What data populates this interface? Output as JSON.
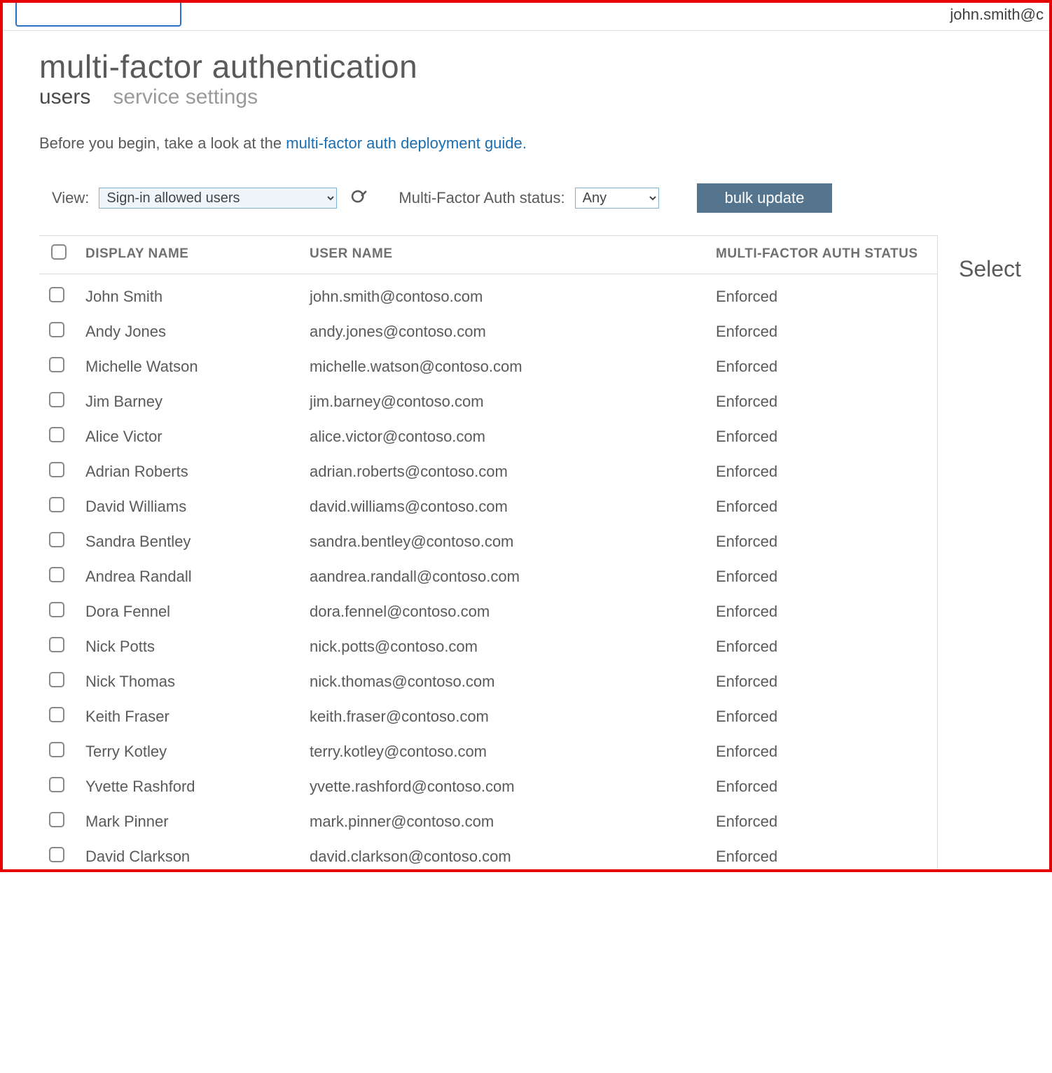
{
  "header": {
    "user_email_partial": "john.smith@c"
  },
  "page": {
    "title": "multi-factor authentication",
    "tabs": [
      {
        "id": "users",
        "label": "users",
        "active": true
      },
      {
        "id": "service-settings",
        "label": "service settings",
        "active": false
      }
    ],
    "intro_prefix": "Before you begin, take a look at the ",
    "intro_link_text": "multi-factor auth deployment guide.",
    "filters": {
      "view_label": "View:",
      "view_value": "Sign-in allowed users",
      "status_label": "Multi-Factor Auth status:",
      "status_value": "Any",
      "bulk_update_label": "bulk update"
    },
    "columns": {
      "display_name": "DISPLAY NAME",
      "user_name": "USER NAME",
      "mfa_status": "MULTI-FACTOR AUTH STATUS"
    },
    "side_panel_text": "Select",
    "users": [
      {
        "display_name": "John Smith",
        "user_name": "john.smith@contoso.com",
        "status": "Enforced"
      },
      {
        "display_name": "Andy Jones",
        "user_name": "andy.jones@contoso.com",
        "status": "Enforced"
      },
      {
        "display_name": "Michelle Watson",
        "user_name": "michelle.watson@contoso.com",
        "status": "Enforced"
      },
      {
        "display_name": "Jim Barney",
        "user_name": "jim.barney@contoso.com",
        "status": "Enforced"
      },
      {
        "display_name": "Alice Victor",
        "user_name": "alice.victor@contoso.com",
        "status": "Enforced"
      },
      {
        "display_name": "Adrian Roberts",
        "user_name": "adrian.roberts@contoso.com",
        "status": "Enforced"
      },
      {
        "display_name": "David Williams",
        "user_name": "david.williams@contoso.com",
        "status": "Enforced"
      },
      {
        "display_name": "Sandra Bentley",
        "user_name": "sandra.bentley@contoso.com",
        "status": "Enforced"
      },
      {
        "display_name": "Andrea Randall",
        "user_name": "aandrea.randall@contoso.com",
        "status": "Enforced"
      },
      {
        "display_name": "Dora Fennel",
        "user_name": "dora.fennel@contoso.com",
        "status": "Enforced"
      },
      {
        "display_name": "Nick Potts",
        "user_name": "nick.potts@contoso.com",
        "status": "Enforced"
      },
      {
        "display_name": "Nick Thomas",
        "user_name": "nick.thomas@contoso.com",
        "status": "Enforced"
      },
      {
        "display_name": "Keith Fraser",
        "user_name": "keith.fraser@contoso.com",
        "status": "Enforced"
      },
      {
        "display_name": "Terry Kotley",
        "user_name": "terry.kotley@contoso.com",
        "status": "Enforced"
      },
      {
        "display_name": "Yvette Rashford",
        "user_name": "yvette.rashford@contoso.com",
        "status": "Enforced"
      },
      {
        "display_name": "Mark Pinner",
        "user_name": "mark.pinner@contoso.com",
        "status": "Enforced"
      },
      {
        "display_name": "David Clarkson",
        "user_name": "david.clarkson@contoso.com",
        "status": "Enforced"
      }
    ]
  }
}
